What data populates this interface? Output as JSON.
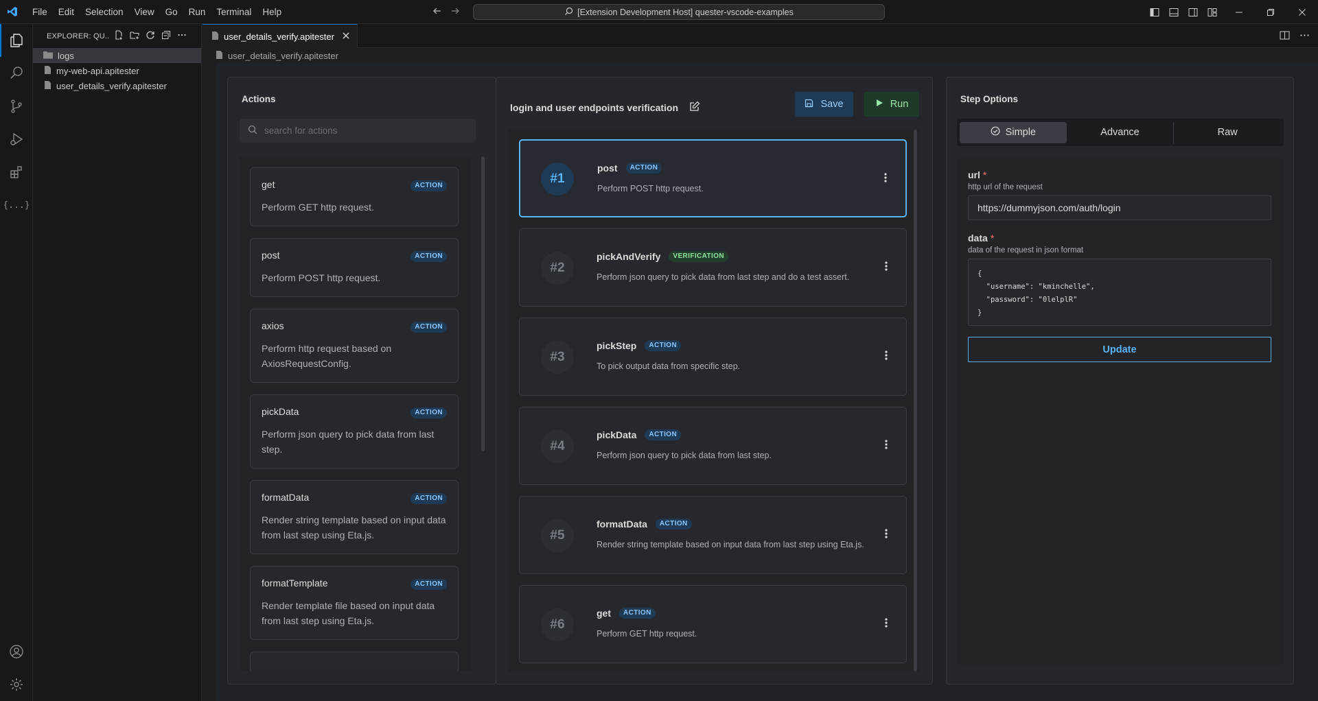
{
  "menu": [
    "File",
    "Edit",
    "Selection",
    "View",
    "Go",
    "Run",
    "Terminal",
    "Help"
  ],
  "command_center": "[Extension Development Host] quester-vscode-examples",
  "sidebar": {
    "title": "EXPLORER: QU...",
    "items": [
      {
        "label": "logs",
        "type": "folder"
      },
      {
        "label": "my-web-api.apitester",
        "type": "file"
      },
      {
        "label": "user_details_verify.apitester",
        "type": "file"
      }
    ]
  },
  "tab": {
    "label": "user_details_verify.apitester"
  },
  "breadcrumb": "user_details_verify.apitester",
  "actions_panel": {
    "title": "Actions",
    "search_placeholder": "search for actions",
    "items": [
      {
        "name": "get",
        "badge": "ACTION",
        "desc": "Perform GET http request."
      },
      {
        "name": "post",
        "badge": "ACTION",
        "desc": "Perform POST http request."
      },
      {
        "name": "axios",
        "badge": "ACTION",
        "desc": "Perform http request based on AxiosRequestConfig."
      },
      {
        "name": "pickData",
        "badge": "ACTION",
        "desc": "Perform json query to pick data from last step."
      },
      {
        "name": "formatData",
        "badge": "ACTION",
        "desc": "Render string template based on input data from last step using Eta.js."
      },
      {
        "name": "formatTemplate",
        "badge": "ACTION",
        "desc": "Render template file based on input data from last step using Eta.js."
      }
    ]
  },
  "steps_panel": {
    "title": "login and user endpoints verification",
    "save_label": "Save",
    "run_label": "Run",
    "steps": [
      {
        "num": "#1",
        "name": "post",
        "badge": "ACTION",
        "desc": "Perform POST http request."
      },
      {
        "num": "#2",
        "name": "pickAndVerify",
        "badge": "VERIFICATION",
        "desc": "Perform json query to pick data from last step and do a test assert."
      },
      {
        "num": "#3",
        "name": "pickStep",
        "badge": "ACTION",
        "desc": "To pick output data from specific step."
      },
      {
        "num": "#4",
        "name": "pickData",
        "badge": "ACTION",
        "desc": "Perform json query to pick data from last step."
      },
      {
        "num": "#5",
        "name": "formatData",
        "badge": "ACTION",
        "desc": "Render string template based on input data from last step using Eta.js."
      },
      {
        "num": "#6",
        "name": "get",
        "badge": "ACTION",
        "desc": "Perform GET http request."
      }
    ]
  },
  "options_panel": {
    "title": "Step Options",
    "tabs": [
      "Simple",
      "Advance",
      "Raw"
    ],
    "url_label": "url",
    "url_hint": "http url of the request",
    "url_value": "https://dummyjson.com/auth/login",
    "data_label": "data",
    "data_hint": "data of the request in json format",
    "data_value": "{\n  \"username\": \"kminchelle\",\n  \"password\": \"0lelplR\"\n}",
    "required_mark": "*",
    "update_label": "Update"
  },
  "colors": {
    "accent": "#0078d4",
    "selected_border": "#5ab4f5",
    "required": "#ff6b6b"
  }
}
